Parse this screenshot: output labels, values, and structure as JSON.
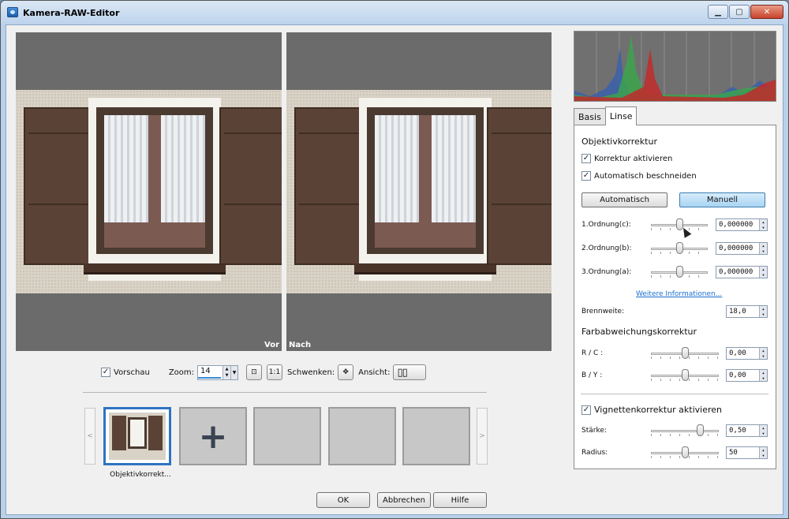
{
  "window": {
    "title": "Kamera-RAW-Editor",
    "min_icon": "minimize-icon",
    "max_icon": "maximize-icon",
    "close_icon": "close-icon"
  },
  "preview": {
    "before_label": "Vor",
    "after_label": "Nach"
  },
  "toolbar": {
    "preview_label": "Vorschau",
    "preview_checked": true,
    "zoom_label": "Zoom:",
    "zoom_value": "14",
    "pan_label": "Schwenken:",
    "view_label": "Ansicht:"
  },
  "filmstrip": {
    "selected_label": "Objektivkorrekt..."
  },
  "buttons": {
    "ok": "OK",
    "cancel": "Abbrechen",
    "help": "Hilfe"
  },
  "tabs": [
    {
      "label": "Basis"
    },
    {
      "label": "Linse"
    }
  ],
  "lens": {
    "section_title": "Objektivkorrektur",
    "enable_label": "Korrektur aktivieren",
    "autocrop_label": "Automatisch beschneiden",
    "btn_auto": "Automatisch",
    "btn_manual": "Manuell",
    "orders": [
      {
        "label": "1.Ordnung(c):",
        "value": "0,000000",
        "level": 0.5
      },
      {
        "label": "2.Ordnung(b):",
        "value": "0,000000",
        "level": 0.5
      },
      {
        "label": "3.Ordnung(a):",
        "value": "0,000000",
        "level": 0.5
      }
    ],
    "more_info": "Weitere Informationen...",
    "focal_label": "Brennweite:",
    "focal_value": "18,0"
  },
  "chroma": {
    "section_title": "Farbabweichungskorrektur",
    "rc_label": "R / C :",
    "rc_value": "0,00",
    "rc_level": 0.5,
    "by_label": "B / Y :",
    "by_value": "0,00",
    "by_level": 0.5
  },
  "vignette": {
    "enable_label": "Vignettenkorrektur aktivieren",
    "strength_label": "Stärke:",
    "strength_value": "0,50",
    "strength_level": 0.75,
    "radius_label": "Radius:",
    "radius_value": "50",
    "radius_level": 0.5
  }
}
